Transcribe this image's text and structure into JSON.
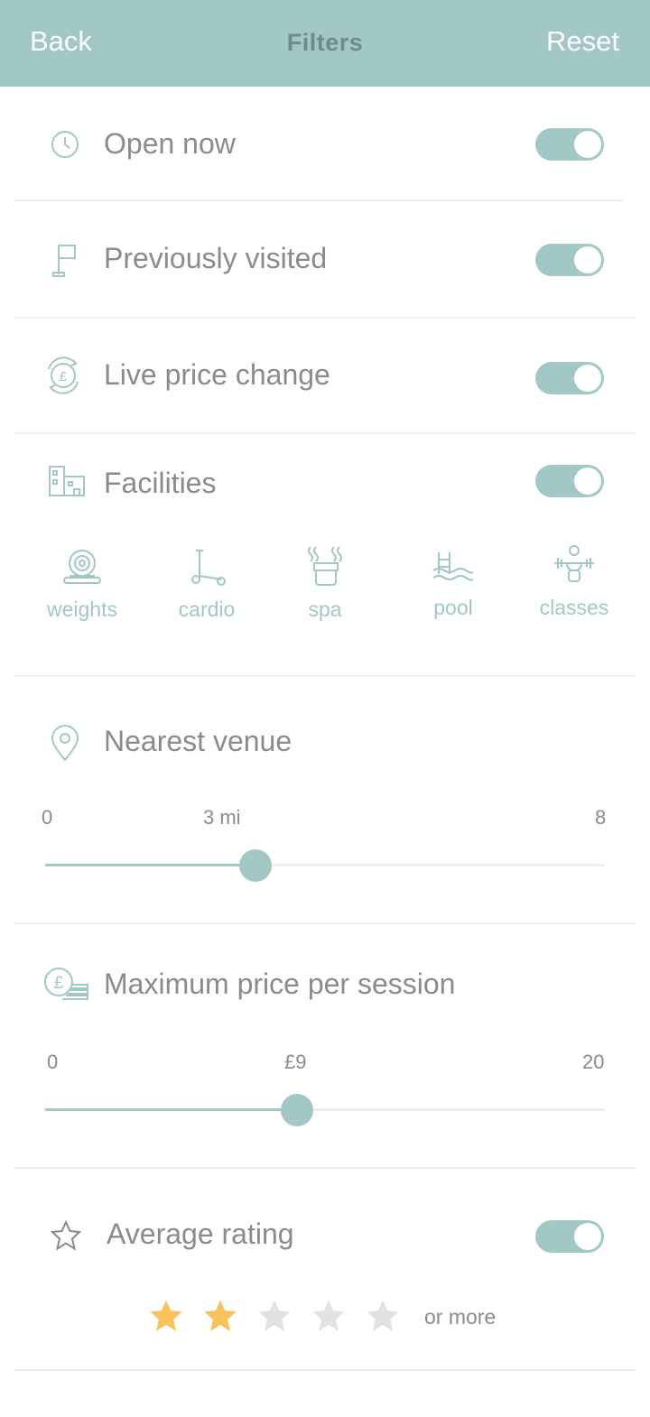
{
  "header": {
    "back_label": "Back",
    "title": "Filters",
    "reset_label": "Reset"
  },
  "filters": {
    "open_now": {
      "label": "Open now",
      "enabled": true
    },
    "previously_visited": {
      "label": "Previously visited",
      "enabled": true
    },
    "live_price_change": {
      "label": "Live price change",
      "enabled": true
    },
    "facilities": {
      "label": "Facilities",
      "enabled": true,
      "items": [
        {
          "label": "weights",
          "icon": "weights-icon"
        },
        {
          "label": "cardio",
          "icon": "cardio-icon"
        },
        {
          "label": "spa",
          "icon": "spa-icon"
        },
        {
          "label": "pool",
          "icon": "pool-icon"
        },
        {
          "label": "classes",
          "icon": "classes-icon"
        }
      ]
    },
    "nearest_venue": {
      "label": "Nearest venue",
      "min": "0",
      "max": "8",
      "value_label": "3 mi",
      "value": 3
    },
    "max_price": {
      "label": "Maximum price per session",
      "min": "0",
      "max": "20",
      "value_label": "£9",
      "value": 9
    },
    "average_rating": {
      "label": "Average rating",
      "enabled": true,
      "rating": 2,
      "max_rating": 5,
      "suffix": "or more"
    }
  },
  "colors": {
    "header": "#a1c8c4",
    "accent": "#a1c8c4",
    "star_active": "#fbc25c",
    "star_inactive": "#e2e2e2"
  }
}
